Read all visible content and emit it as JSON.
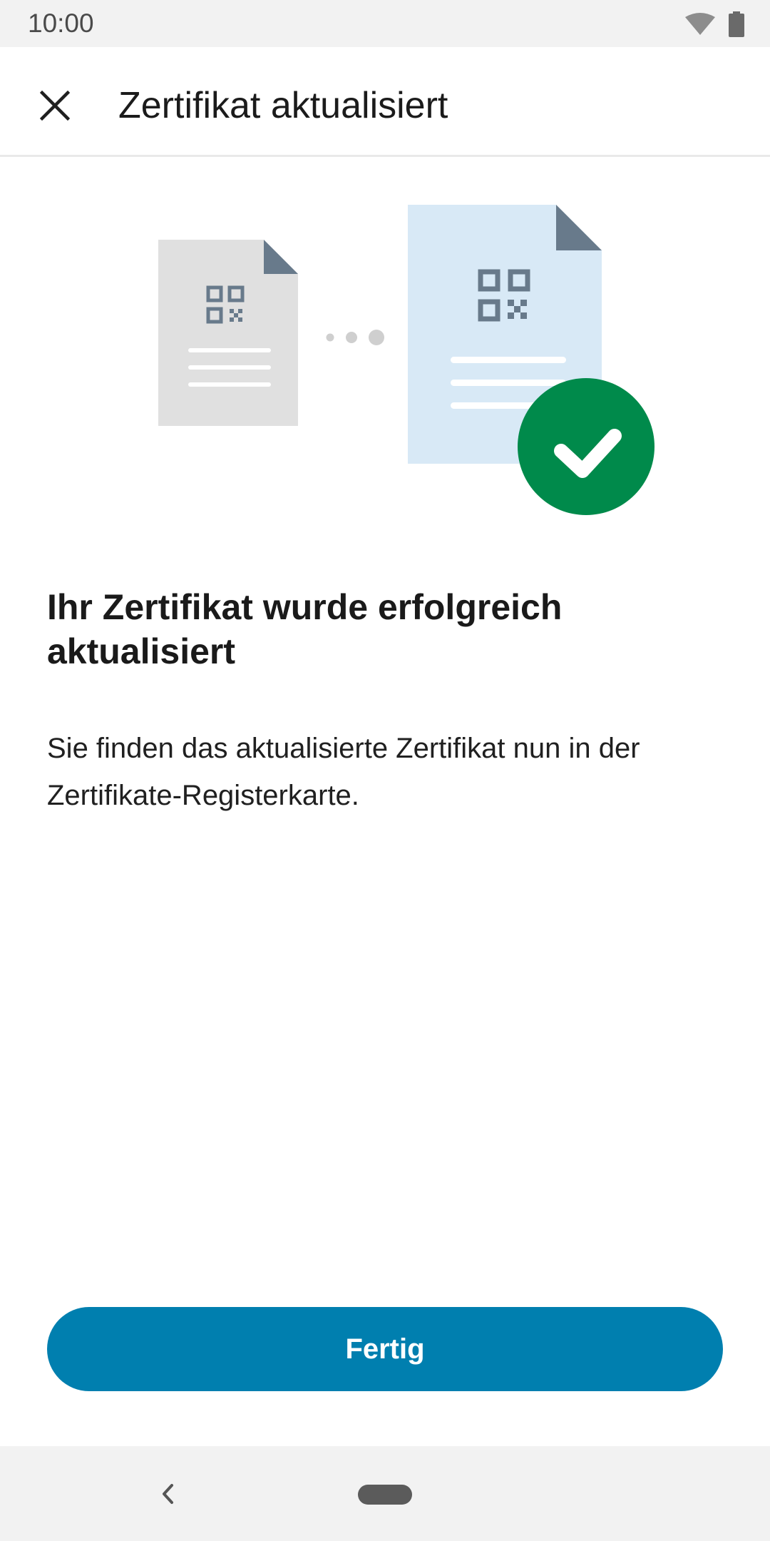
{
  "status_bar": {
    "time": "10:00",
    "icons": [
      "wifi-icon",
      "battery-icon"
    ]
  },
  "app_bar": {
    "title": "Zertifikat aktualisiert",
    "close_icon": "close-icon"
  },
  "illustration": {
    "old_certificate_icon": "document-qr-icon",
    "new_certificate_icon": "document-qr-icon",
    "transition_icon": "dots-icon",
    "success_icon": "check-circle-icon",
    "colors": {
      "old_doc": "#e0e0e0",
      "new_doc": "#d8e9f6",
      "doc_corner": "#687a8b",
      "success": "#008a4b"
    }
  },
  "content": {
    "heading": "Ihr Zertifikat wurde erfolgreich aktualisiert",
    "body": "Sie finden das aktualisierte Zertifikat nun in der Zertifikate-Registerkarte."
  },
  "actions": {
    "done_label": "Fertig",
    "accent_color": "#007faf"
  },
  "nav_bar": {
    "icons": [
      "back-icon",
      "home-pill"
    ]
  }
}
